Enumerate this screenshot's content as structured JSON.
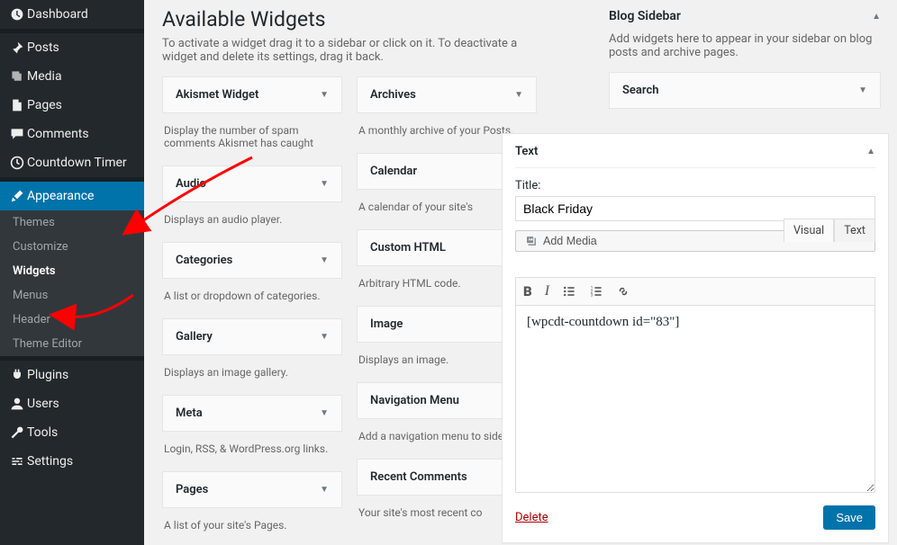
{
  "nav": {
    "dashboard": "Dashboard",
    "posts": "Posts",
    "media": "Media",
    "pages": "Pages",
    "comments": "Comments",
    "countdown": "Countdown Timer",
    "appearance": "Appearance",
    "plugins": "Plugins",
    "users": "Users",
    "tools": "Tools",
    "settings": "Settings"
  },
  "appearance_sub": {
    "themes": "Themes",
    "customize": "Customize",
    "widgets": "Widgets",
    "menus": "Menus",
    "header": "Header",
    "theme_editor": "Theme Editor"
  },
  "main": {
    "heading": "Available Widgets",
    "desc": "To activate a widget drag it to a sidebar or click on it. To deactivate a widget and delete its settings, drag it back."
  },
  "widgets_col1": [
    {
      "title": "Akismet Widget",
      "desc": "Display the number of spam comments Akismet has caught"
    },
    {
      "title": "Audio",
      "desc": "Displays an audio player."
    },
    {
      "title": "Categories",
      "desc": "A list or dropdown of categories."
    },
    {
      "title": "Gallery",
      "desc": "Displays an image gallery."
    },
    {
      "title": "Meta",
      "desc": "Login, RSS, & WordPress.org links."
    },
    {
      "title": "Pages",
      "desc": "A list of your site's Pages."
    }
  ],
  "widgets_col2": [
    {
      "title": "Archives",
      "desc": "A monthly archive of your Posts."
    },
    {
      "title": "Calendar",
      "desc": "A calendar of your site's"
    },
    {
      "title": "Custom HTML",
      "desc": "Arbitrary HTML code."
    },
    {
      "title": "Image",
      "desc": "Displays an image."
    },
    {
      "title": "Navigation Menu",
      "desc": "Add a navigation menu to sidebar."
    },
    {
      "title": "Recent Comments",
      "desc": "Your site's most recent co"
    }
  ],
  "sidebar_panel": {
    "title": "Blog Sidebar",
    "desc": "Add widgets here to appear in your sidebar on blog posts and archive pages.",
    "search": "Search"
  },
  "text_widget": {
    "header": "Text",
    "title_label": "Title:",
    "title_value": "Black Friday",
    "add_media": "Add Media",
    "tab_visual": "Visual",
    "tab_text": "Text",
    "content": "[wpcdt-countdown id=\"83\"]",
    "delete": "Delete",
    "save": "Save"
  }
}
